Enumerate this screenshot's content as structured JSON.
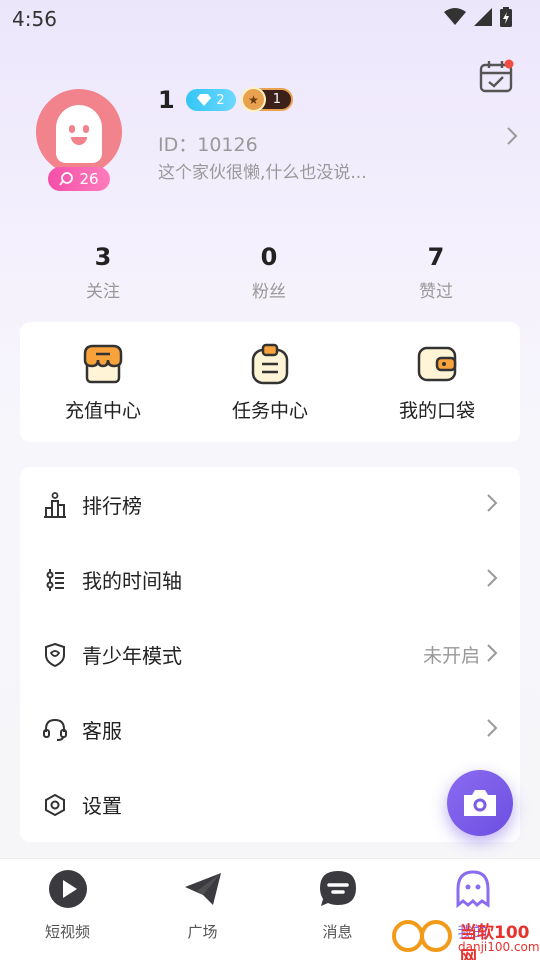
{
  "status_bar": {
    "time": "4:56"
  },
  "profile": {
    "username": "1",
    "vip_level": "2",
    "rank_level": "1",
    "user_id": "ID：10126",
    "bio": "这个家伙很懒,什么也没说...",
    "fans_badge_count": "26"
  },
  "stats": [
    {
      "value": "3",
      "label": "关注"
    },
    {
      "value": "0",
      "label": "粉丝"
    },
    {
      "value": "7",
      "label": "赞过"
    }
  ],
  "quick_actions": [
    {
      "label": "充值中心",
      "icon": "shop-icon"
    },
    {
      "label": "任务中心",
      "icon": "task-icon"
    },
    {
      "label": "我的口袋",
      "icon": "wallet-icon"
    }
  ],
  "menu": [
    {
      "label": "排行榜",
      "value": "",
      "icon": "ranking-icon"
    },
    {
      "label": "我的时间轴",
      "value": "",
      "icon": "timeline-icon"
    },
    {
      "label": "青少年模式",
      "value": "未开启",
      "icon": "shield-icon"
    },
    {
      "label": "客服",
      "value": "",
      "icon": "headset-icon"
    },
    {
      "label": "设置",
      "value": "",
      "icon": "settings-icon"
    }
  ],
  "bottom_nav": [
    {
      "label": "短视频",
      "icon": "play-icon"
    },
    {
      "label": "广场",
      "icon": "plane-icon"
    },
    {
      "label": "消息",
      "icon": "message-icon"
    },
    {
      "label": "我的",
      "icon": "profile-ghost-icon",
      "active": true
    }
  ],
  "watermark": {
    "line1": "当软100网",
    "line2": "danji100.com"
  },
  "colors": {
    "accent": "#8a6cf1",
    "pink": "#f2828c",
    "badge_blue": "#33c6f5",
    "orange": "#f29b1a"
  }
}
